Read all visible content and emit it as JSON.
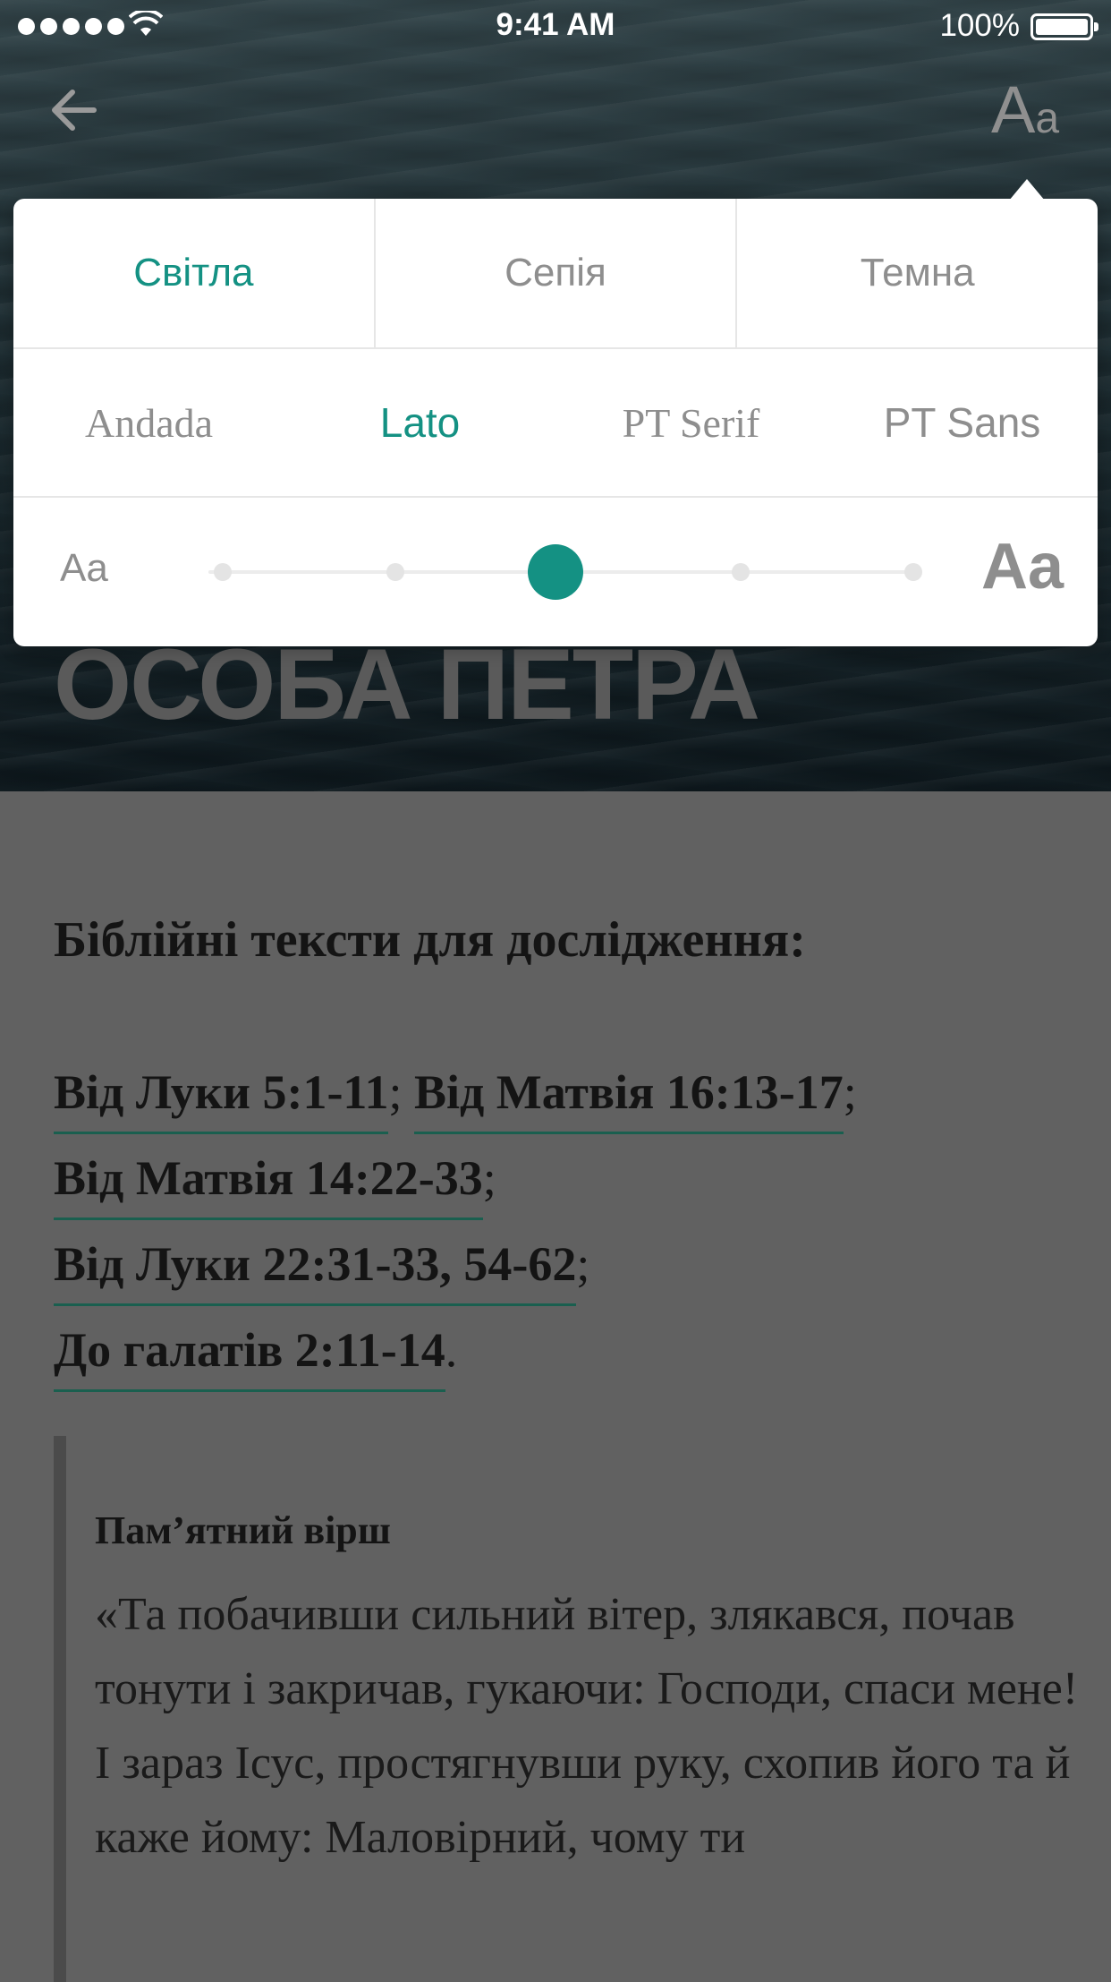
{
  "status_bar": {
    "time": "9:41 AM",
    "battery": "100%"
  },
  "nav": {
    "back_icon": "arrow-left-icon",
    "text_settings": {
      "big": "A",
      "small": "a"
    }
  },
  "hero": {
    "title": "ОСОБА ПЕТРА"
  },
  "settings_popover": {
    "themes": [
      {
        "label": "Світла",
        "active": true
      },
      {
        "label": "Сепія",
        "active": false
      },
      {
        "label": "Темна",
        "active": false
      }
    ],
    "fonts": [
      {
        "label": "Andada",
        "active": false
      },
      {
        "label": "Lato",
        "active": true
      },
      {
        "label": "PT Serif",
        "active": false
      },
      {
        "label": "PT Sans",
        "active": false
      }
    ],
    "size": {
      "small_label": "Aa",
      "large_label": "Aa",
      "steps": 5,
      "selected_step": 3
    },
    "accent_color": "#149183"
  },
  "content": {
    "section_heading": "Біблійні тексти для дослідження:",
    "references": [
      {
        "text": "Від Луки 5:1-11",
        "after": ";"
      },
      {
        "text": "Від Матвія 16:13-17",
        "after": ";"
      },
      {
        "text": "Від Матвія 14:22-33",
        "after": ";"
      },
      {
        "text": "Від Луки 22:31-33, 54-62",
        "after": ";"
      },
      {
        "text": "До галатів 2:11-14",
        "after": "."
      }
    ],
    "memory_verse": {
      "title": "Пам’ятний вірш",
      "text": "«Та побачивши сильний вітер, злякався, почав тонути і закричав, гукаючи: Господи, спаси мене! І зараз Ісус, простягнувши руку, схопив його та й каже йому: Маловірний, чому ти"
    }
  }
}
